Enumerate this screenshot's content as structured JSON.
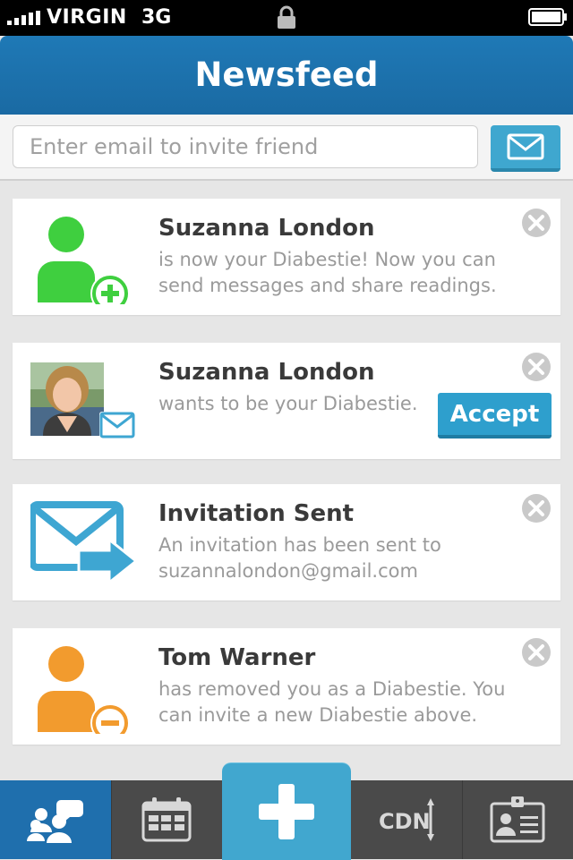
{
  "status_bar": {
    "carrier": "VIRGIN",
    "network": "3G"
  },
  "nav": {
    "title": "Newsfeed"
  },
  "invite": {
    "placeholder": "Enter email to invite friend",
    "button_icon": "envelope-icon"
  },
  "feed": [
    {
      "type": "added",
      "name": "Suzanna London",
      "message": "is now your Diabestie! Now you can send messages and share readings.",
      "icon": "person-add-icon",
      "icon_color": "#3fcf3f"
    },
    {
      "type": "request",
      "name": "Suzanna London",
      "message": "wants to be your Diabestie.",
      "action_label": "Accept",
      "icon": "avatar-photo"
    },
    {
      "type": "sent",
      "name": "Invitation Sent",
      "message": "An invitation has been sent to suzannalondon@gmail.com",
      "icon": "envelope-sent-icon",
      "icon_color": "#3ea6d2"
    },
    {
      "type": "removed",
      "name": "Tom Warner",
      "message": "has removed you as a Diabestie. You can invite a new Diabestie above.",
      "icon": "person-remove-icon",
      "icon_color": "#f29b2e"
    }
  ],
  "tabbar": {
    "tabs": [
      {
        "icon": "people-chat-icon",
        "active": true
      },
      {
        "icon": "calendar-icon",
        "active": false
      },
      {
        "icon": "plus-icon",
        "active": false
      },
      {
        "icon": "cdn-icon",
        "label": "CDN",
        "active": false
      },
      {
        "icon": "id-card-icon",
        "active": false
      }
    ]
  },
  "colors": {
    "primary": "#1a6aa3",
    "accent": "#41a7cf",
    "background": "#e6e6e6"
  }
}
